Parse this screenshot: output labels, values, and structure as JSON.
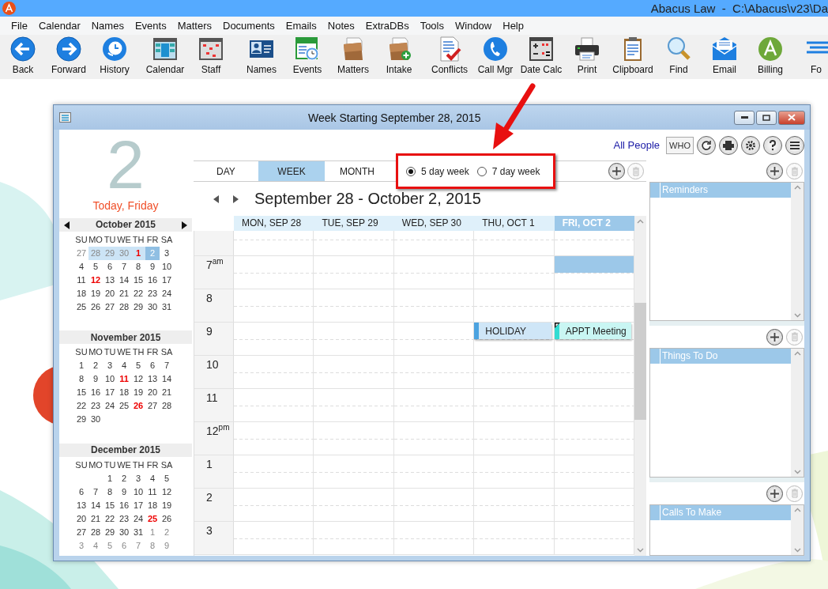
{
  "app_title": "Abacus Law  -  C:\\Abacus\\v23\\Da",
  "menu": [
    "File",
    "Calendar",
    "Names",
    "Events",
    "Matters",
    "Documents",
    "Emails",
    "Notes",
    "ExtraDBs",
    "Tools",
    "Window",
    "Help"
  ],
  "toolbar": [
    [
      {
        "label": "Back",
        "kind": "back"
      },
      {
        "label": "Forward",
        "kind": "forward"
      },
      {
        "label": "History",
        "kind": "history"
      }
    ],
    [
      {
        "label": "Calendar",
        "kind": "calendar"
      },
      {
        "label": "Staff",
        "kind": "staff"
      }
    ],
    [
      {
        "label": "Names",
        "kind": "names"
      },
      {
        "label": "Events",
        "kind": "events"
      },
      {
        "label": "Matters",
        "kind": "matters"
      },
      {
        "label": "Intake",
        "kind": "intake"
      }
    ],
    [
      {
        "label": "Conflicts",
        "kind": "conflicts"
      },
      {
        "label": "Call Mgr",
        "kind": "phone"
      },
      {
        "label": "Date Calc",
        "kind": "datecalc"
      },
      {
        "label": "Print",
        "kind": "print"
      },
      {
        "label": "Clipboard",
        "kind": "clipboard"
      },
      {
        "label": "Find",
        "kind": "find"
      },
      {
        "label": "Email",
        "kind": "email"
      },
      {
        "label": "Billing",
        "kind": "billing"
      },
      {
        "label": "Fo",
        "kind": "forms"
      }
    ]
  ],
  "window": {
    "title": "Week Starting September 28, 2015",
    "big_day": "2",
    "today_label": "Today, Friday",
    "months": [
      {
        "title": "October 2015",
        "arrows": true,
        "day_names": [
          "SU",
          "MO",
          "TU",
          "WE",
          "TH",
          "FR",
          "SA"
        ],
        "weeks": [
          [
            {
              "d": "27",
              "kind": "muted"
            },
            {
              "d": "28",
              "kind": "week"
            },
            {
              "d": "29",
              "kind": "week"
            },
            {
              "d": "30",
              "kind": "week"
            },
            {
              "d": "1",
              "kind": "week-red"
            },
            {
              "d": "2",
              "kind": "selected"
            },
            {
              "d": "3",
              "kind": "day"
            }
          ],
          [
            {
              "d": "4",
              "kind": "day"
            },
            {
              "d": "5",
              "kind": "day"
            },
            {
              "d": "6",
              "kind": "day"
            },
            {
              "d": "7",
              "kind": "day"
            },
            {
              "d": "8",
              "kind": "day"
            },
            {
              "d": "9",
              "kind": "day"
            },
            {
              "d": "10",
              "kind": "day"
            }
          ],
          [
            {
              "d": "11",
              "kind": "day"
            },
            {
              "d": "12",
              "kind": "red"
            },
            {
              "d": "13",
              "kind": "day"
            },
            {
              "d": "14",
              "kind": "day"
            },
            {
              "d": "15",
              "kind": "day"
            },
            {
              "d": "16",
              "kind": "day"
            },
            {
              "d": "17",
              "kind": "day"
            }
          ],
          [
            {
              "d": "18",
              "kind": "day"
            },
            {
              "d": "19",
              "kind": "day"
            },
            {
              "d": "20",
              "kind": "day"
            },
            {
              "d": "21",
              "kind": "day"
            },
            {
              "d": "22",
              "kind": "day"
            },
            {
              "d": "23",
              "kind": "day"
            },
            {
              "d": "24",
              "kind": "day"
            }
          ],
          [
            {
              "d": "25",
              "kind": "day"
            },
            {
              "d": "26",
              "kind": "day"
            },
            {
              "d": "27",
              "kind": "day"
            },
            {
              "d": "28",
              "kind": "day"
            },
            {
              "d": "29",
              "kind": "day"
            },
            {
              "d": "30",
              "kind": "day"
            },
            {
              "d": "31",
              "kind": "day"
            }
          ]
        ]
      },
      {
        "title": "November 2015",
        "arrows": false,
        "day_names": [
          "SU",
          "MO",
          "TU",
          "WE",
          "TH",
          "FR",
          "SA"
        ],
        "weeks": [
          [
            {
              "d": "1",
              "kind": "day"
            },
            {
              "d": "2",
              "kind": "day"
            },
            {
              "d": "3",
              "kind": "day"
            },
            {
              "d": "4",
              "kind": "day"
            },
            {
              "d": "5",
              "kind": "day"
            },
            {
              "d": "6",
              "kind": "day"
            },
            {
              "d": "7",
              "kind": "day"
            }
          ],
          [
            {
              "d": "8",
              "kind": "day"
            },
            {
              "d": "9",
              "kind": "day"
            },
            {
              "d": "10",
              "kind": "day"
            },
            {
              "d": "11",
              "kind": "red"
            },
            {
              "d": "12",
              "kind": "day"
            },
            {
              "d": "13",
              "kind": "day"
            },
            {
              "d": "14",
              "kind": "day"
            }
          ],
          [
            {
              "d": "15",
              "kind": "day"
            },
            {
              "d": "16",
              "kind": "day"
            },
            {
              "d": "17",
              "kind": "day"
            },
            {
              "d": "18",
              "kind": "day"
            },
            {
              "d": "19",
              "kind": "day"
            },
            {
              "d": "20",
              "kind": "day"
            },
            {
              "d": "21",
              "kind": "day"
            }
          ],
          [
            {
              "d": "22",
              "kind": "day"
            },
            {
              "d": "23",
              "kind": "day"
            },
            {
              "d": "24",
              "kind": "day"
            },
            {
              "d": "25",
              "kind": "day"
            },
            {
              "d": "26",
              "kind": "red"
            },
            {
              "d": "27",
              "kind": "day"
            },
            {
              "d": "28",
              "kind": "day"
            }
          ],
          [
            {
              "d": "29",
              "kind": "day"
            },
            {
              "d": "30",
              "kind": "day"
            }
          ]
        ]
      },
      {
        "title": "December 2015",
        "arrows": false,
        "day_names": [
          "SU",
          "MO",
          "TU",
          "WE",
          "TH",
          "FR",
          "SA"
        ],
        "weeks": [
          [
            {
              "kind": "blank"
            },
            {
              "kind": "blank"
            },
            {
              "d": "1",
              "kind": "day"
            },
            {
              "d": "2",
              "kind": "day"
            },
            {
              "d": "3",
              "kind": "day"
            },
            {
              "d": "4",
              "kind": "day"
            },
            {
              "d": "5",
              "kind": "day"
            }
          ],
          [
            {
              "d": "6",
              "kind": "day"
            },
            {
              "d": "7",
              "kind": "day"
            },
            {
              "d": "8",
              "kind": "day"
            },
            {
              "d": "9",
              "kind": "day"
            },
            {
              "d": "10",
              "kind": "day"
            },
            {
              "d": "11",
              "kind": "day"
            },
            {
              "d": "12",
              "kind": "day"
            }
          ],
          [
            {
              "d": "13",
              "kind": "day"
            },
            {
              "d": "14",
              "kind": "day"
            },
            {
              "d": "15",
              "kind": "day"
            },
            {
              "d": "16",
              "kind": "day"
            },
            {
              "d": "17",
              "kind": "day"
            },
            {
              "d": "18",
              "kind": "day"
            },
            {
              "d": "19",
              "kind": "day"
            }
          ],
          [
            {
              "d": "20",
              "kind": "day"
            },
            {
              "d": "21",
              "kind": "day"
            },
            {
              "d": "22",
              "kind": "day"
            },
            {
              "d": "23",
              "kind": "day"
            },
            {
              "d": "24",
              "kind": "day"
            },
            {
              "d": "25",
              "kind": "red"
            },
            {
              "d": "26",
              "kind": "day"
            }
          ],
          [
            {
              "d": "27",
              "kind": "day"
            },
            {
              "d": "28",
              "kind": "day"
            },
            {
              "d": "29",
              "kind": "day"
            },
            {
              "d": "30",
              "kind": "day"
            },
            {
              "d": "31",
              "kind": "day"
            },
            {
              "d": "1",
              "kind": "muted"
            },
            {
              "d": "2",
              "kind": "muted"
            }
          ],
          [
            {
              "d": "3",
              "kind": "muted"
            },
            {
              "d": "4",
              "kind": "muted"
            },
            {
              "d": "5",
              "kind": "muted"
            },
            {
              "d": "6",
              "kind": "muted"
            },
            {
              "d": "7",
              "kind": "muted"
            },
            {
              "d": "8",
              "kind": "muted"
            },
            {
              "d": "9",
              "kind": "muted"
            }
          ]
        ]
      }
    ],
    "people_link": "All People",
    "who_button": "WHO",
    "tabs": [
      {
        "label": "DAY",
        "selected": false
      },
      {
        "label": "WEEK",
        "selected": true
      },
      {
        "label": "MONTH",
        "selected": false
      }
    ],
    "week_options": [
      {
        "label": "5 day week",
        "selected": true
      },
      {
        "label": "7 day week",
        "selected": false
      }
    ],
    "range_title": "September 28 - October 2, 2015",
    "days": [
      {
        "label": "MON, SEP 28",
        "selected": false
      },
      {
        "label": "TUE, SEP 29",
        "selected": false
      },
      {
        "label": "WED, SEP 30",
        "selected": false
      },
      {
        "label": "THU, OCT 1",
        "selected": false
      },
      {
        "label": "FRI, OCT 2",
        "selected": true
      }
    ],
    "hours": [
      {
        "label": "7$^{am}$",
        "cells": [
          null,
          null,
          null,
          null,
          {
            "kind": "selection"
          }
        ]
      },
      {
        "label": "8"
      },
      {
        "label": "9",
        "cells": [
          null,
          null,
          null,
          {
            "kind": "event",
            "title": "HOLIDAY",
            "color": "#4ca3e0",
            "flagged": false
          },
          {
            "kind": "event",
            "title": "APPT Meeting",
            "color": "#33dcd2",
            "flagged": true
          }
        ]
      },
      {
        "label": "10"
      },
      {
        "label": "11"
      },
      {
        "label": "12$^{pm}$"
      },
      {
        "label": "1"
      },
      {
        "label": "2"
      },
      {
        "label": "3"
      }
    ],
    "panels": [
      {
        "title": "Reminders"
      },
      {
        "title": "Things To Do"
      },
      {
        "title": "Calls To Make"
      }
    ]
  }
}
